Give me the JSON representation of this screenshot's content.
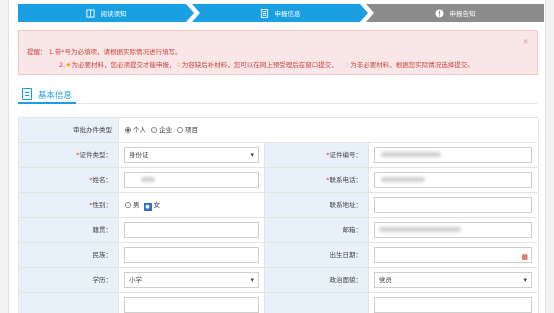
{
  "steps": [
    {
      "label": "阅读须知",
      "state": "done",
      "icon": "book-icon"
    },
    {
      "label": "申报信息",
      "state": "active",
      "icon": "form-icon"
    },
    {
      "label": "申报告知",
      "state": "pending",
      "icon": "info-icon"
    }
  ],
  "notice": {
    "line1": "提醒：  1.带*号为必填项，请根据实际情况进行填写。",
    "line2_a": "2.",
    "line2_b": "为必要材料，您必须提交才能申报，",
    "line2_c": "为容缺后补材料，您可以在网上预受理后在窗口提交，",
    "line2_d": "为非必要材料，根据您实际情况选择提交。",
    "close": "×",
    "colors": {
      "must": "#f1a400",
      "optional": "#c9c9c9"
    }
  },
  "section": {
    "title": "基本信息"
  },
  "form": {
    "type_label": "审批办件类型",
    "type_options": [
      "个人",
      "企业",
      "项目"
    ],
    "type_selected": "个人",
    "id_type_label": "证件类型：",
    "id_type_value": "身份证",
    "id_no_label": "证件编号：",
    "name_label": "姓名：",
    "phone_label": "联系电话：",
    "gender_label": "性别：",
    "gender_options": [
      "男",
      "女"
    ],
    "gender_selected": "女",
    "address_label": "联系地址：",
    "origin_label": "籍贯：",
    "email_label": "邮箱：",
    "ethnic_label": "民族：",
    "birth_label": "出生日期：",
    "edu_label": "学历：",
    "edu_value": "小学",
    "political_label": "政治面貌：",
    "political_value": "党员"
  },
  "colors": {
    "accent": "#1a9fe3",
    "label_bg": "#e8f1fa",
    "pending": "#8c8c8c"
  }
}
